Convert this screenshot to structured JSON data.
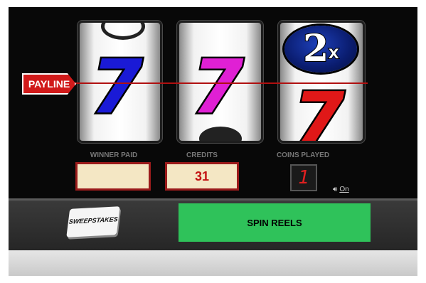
{
  "payline": {
    "label": "PAYLINE"
  },
  "reels": [
    {
      "center_symbol": "7",
      "color": "#1a1ad6"
    },
    {
      "center_symbol": "7",
      "color": "#e020d4"
    },
    {
      "top_symbol": "2x",
      "bottom_symbol": "7",
      "color": "#e01818"
    }
  ],
  "meters": {
    "winner_paid": {
      "label": "WINNER PAID",
      "value": ""
    },
    "credits": {
      "label": "CREDITS",
      "value": "31"
    },
    "coins_played": {
      "label": "COINS PLAYED",
      "value": "1"
    }
  },
  "sound": {
    "icon": "speaker-icon",
    "label": "On"
  },
  "buttons": {
    "sweepstakes": "SWEEPSTAKES",
    "spin": "SPIN REELS"
  },
  "colors": {
    "spin_button": "#2fc25a",
    "meter_border": "#9b1b1b",
    "credits_text": "#c31313"
  }
}
